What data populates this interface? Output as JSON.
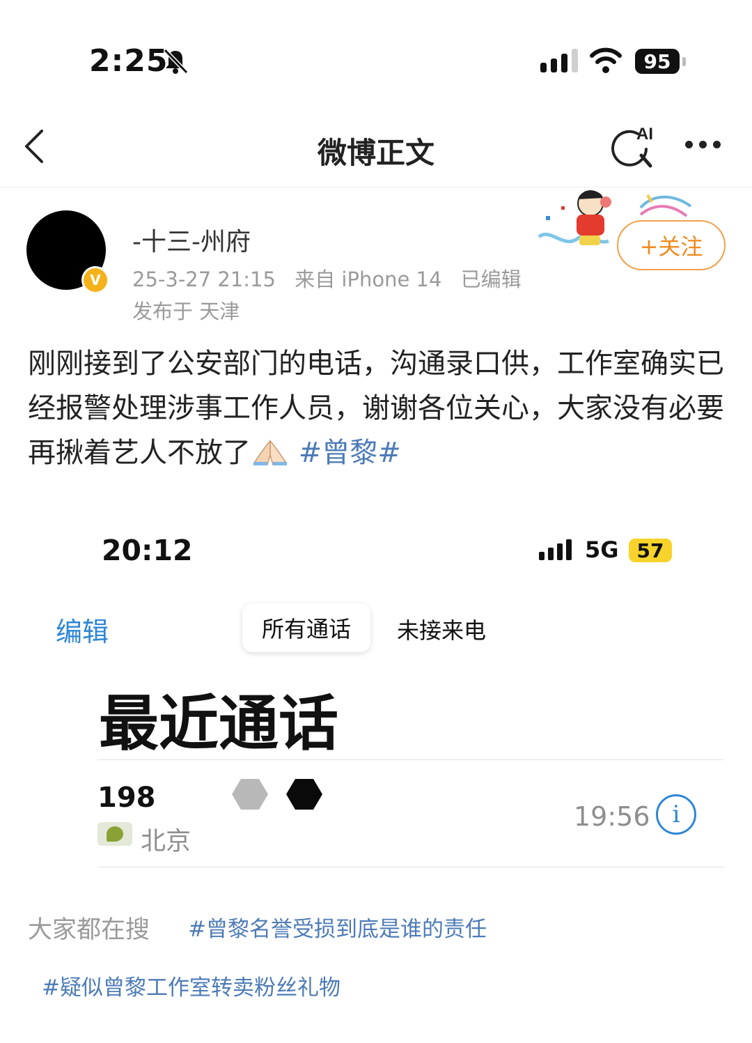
{
  "status_bar": {
    "time": "2:25",
    "battery": "95"
  },
  "nav": {
    "title": "微博正文",
    "ai_label": "AI"
  },
  "author": {
    "name": "-十三-州府",
    "badge": "V",
    "date": "25-3-27 21:15",
    "source": "来自 iPhone 14",
    "edited": "已编辑",
    "location": "发布于 天津",
    "follow_label": "+关注"
  },
  "post": {
    "text": "刚刚接到了公安部门的电话，沟通录口供，工作室确实已经报警处理涉事工作人员，谢谢各位关心，大家没有必要再揪着艺人不放了",
    "hashtag": "#曾黎#"
  },
  "embedded": {
    "time": "20:12",
    "network": "5G",
    "battery": "57",
    "edit_label": "编辑",
    "tab_all": "所有通话",
    "tab_missed": "未接来电",
    "title": "最近通话",
    "call": {
      "number": "198",
      "location": "北京",
      "time": "19:56",
      "info": "i"
    }
  },
  "trending": {
    "label": "大家都在搜",
    "tags": [
      "#曾黎名誉受损到底是谁的责任",
      "#疑似曾黎工作室转卖粉丝礼物"
    ]
  },
  "colors": {
    "link": "#4d7bb7",
    "follow": "#f08a1e",
    "ios_blue": "#2e86d6",
    "battery_yellow": "#f7d32b"
  }
}
